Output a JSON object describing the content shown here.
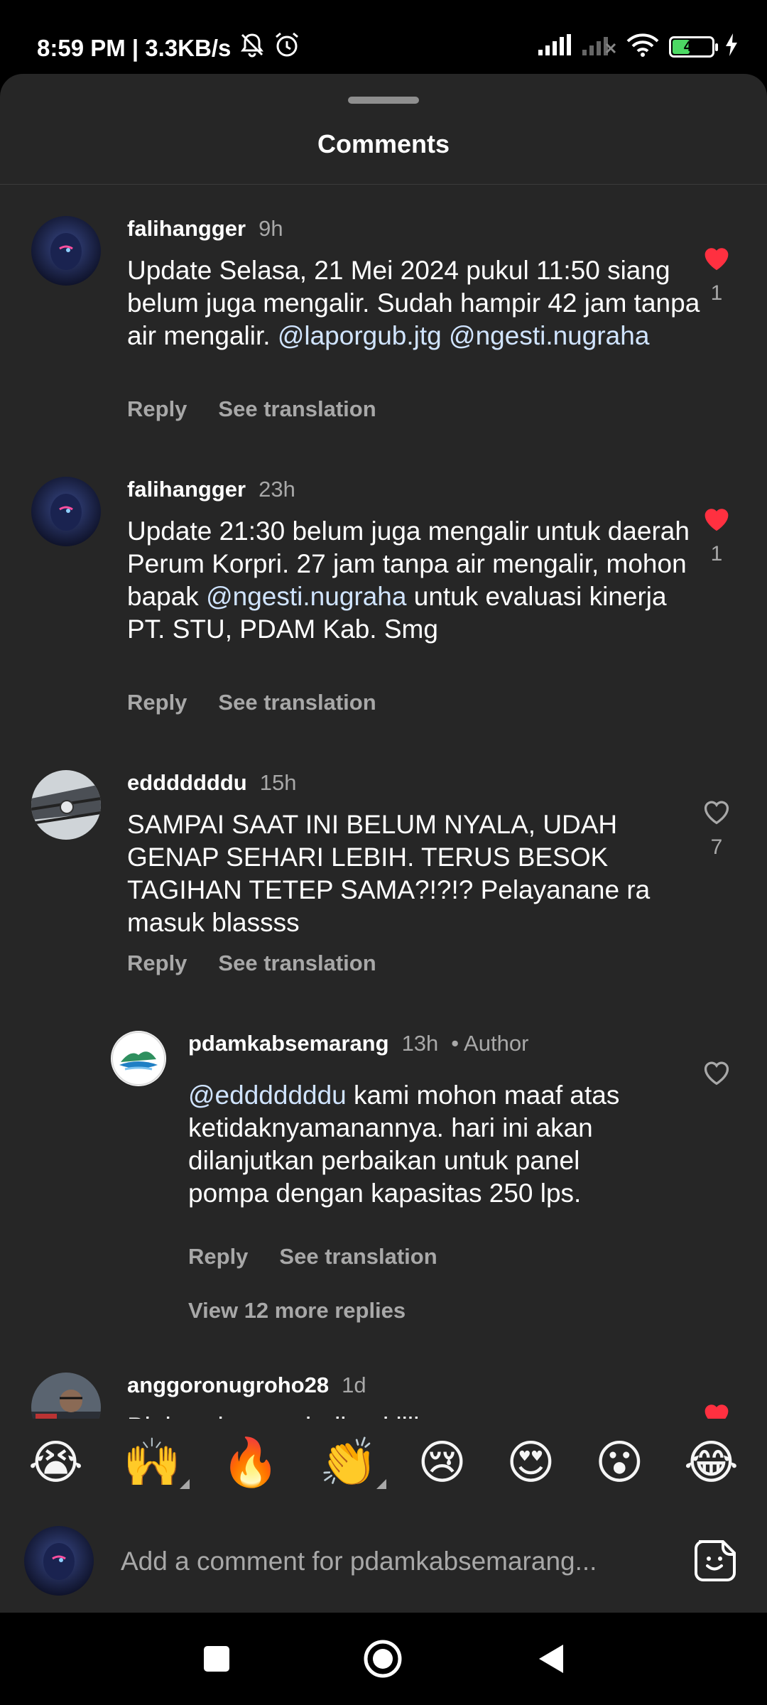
{
  "status_bar": {
    "time_speed": "8:59 PM | 3.3KB/s",
    "battery_level": "45",
    "battery_percent": 45
  },
  "sheet": {
    "title": "Comments"
  },
  "comments": [
    {
      "username": "falihangger",
      "time": "9h",
      "text_parts": [
        "Update Selasa, 21 Mei 2024 pukul 11:50 siang belum juga mengalir. Sudah hampir 42 jam tanpa air mengalir. ",
        "@laporgub.jtg",
        " ",
        "@ngesti.nugraha"
      ],
      "reply_label": "Reply",
      "translate_label": "See translation",
      "liked": true,
      "like_count": "1"
    },
    {
      "username": "falihangger",
      "time": "23h",
      "text_parts": [
        "Update 21:30 belum juga mengalir untuk daerah Perum Korpri. 27 jam tanpa air mengalir, mohon bapak ",
        "@ngesti.nugraha",
        " untuk evaluasi kinerja PT. STU, PDAM Kab. Smg"
      ],
      "reply_label": "Reply",
      "translate_label": "See translation",
      "liked": true,
      "like_count": "1"
    },
    {
      "username": "edddddddu",
      "time": "15h",
      "text": "SAMPAI SAAT INI BELUM NYALA, UDAH GENAP SEHARI LEBIH. TERUS BESOK TAGIHAN TETEP SAMA?!?!? Pelayanane ra masuk blassss",
      "reply_label": "Reply",
      "translate_label": "See translation",
      "liked": false,
      "like_count": "7"
    },
    {
      "username": "pdamkabsemarang",
      "time": "13h",
      "author_label": "• Author",
      "text_parts": [
        "@edddddddu",
        " kami mohon maaf atas ketidaknyamanannya. hari ini akan dilanjutkan perbaikan untuk panel pompa dengan kapasitas 250 lps."
      ],
      "reply_label": "Reply",
      "translate_label": "See translation",
      "liked": false,
      "more_replies": "View 12 more replies"
    },
    {
      "username": "anggoronugroho28",
      "time": "1d",
      "text": "Blaisss kapan dadine kiiih",
      "liked": true
    }
  ],
  "emoji_bar": [
    "😭",
    "🙌",
    "🔥",
    "👏",
    "😢",
    "😍",
    "😮",
    "😂"
  ],
  "comment_input": {
    "placeholder": "Add a comment for pdamkabsemarang..."
  },
  "icons": {
    "like_filled_color": "#ff3040",
    "like_outline_color": "#a8a8a8",
    "mention_color": "#d0e4ff"
  }
}
